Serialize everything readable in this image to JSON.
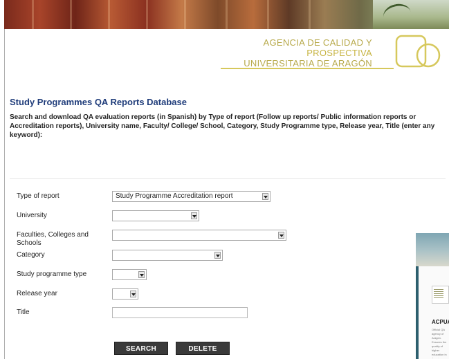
{
  "logo": {
    "line1": "AGENCIA DE CALIDAD Y",
    "line2": "PROSPECTIVA",
    "line3": "UNIVERSITARIA DE ARAGÓN",
    "color": "#c7b442"
  },
  "page": {
    "title": "Study Programmes QA Reports Database",
    "intro": "Search and download QA evaluation reports (in Spanish) by Type of report (Follow up reports/ Public information reports or Accreditation reports), University name, Faculty/ College/ School, Category, Study Programme type, Release year, Title (enter any keyword):"
  },
  "form": {
    "type_label": "Type of report",
    "type_value": "Study Programme Accreditation report",
    "university_label": "University",
    "university_value": "",
    "faculties_label_1": "Faculties, Colleges and",
    "faculties_label_2": "Schools",
    "faculties_value": "",
    "category_label": "Category",
    "category_value": "",
    "programme_type_label": "Study programme type",
    "programme_type_value": "",
    "year_label": "Release year",
    "year_value": "",
    "title_label": "Title",
    "title_value": "",
    "search_label": "SEARCH",
    "delete_label": "DELETE"
  },
  "widget": {
    "name": "ACPUA",
    "text": "Official QA agency of Aragón. Ensures the quality of higher education in Aragón."
  },
  "colors": {
    "heading": "#1f3c7a",
    "button": "#3a3a3a",
    "widget": "#2d5f6e"
  }
}
